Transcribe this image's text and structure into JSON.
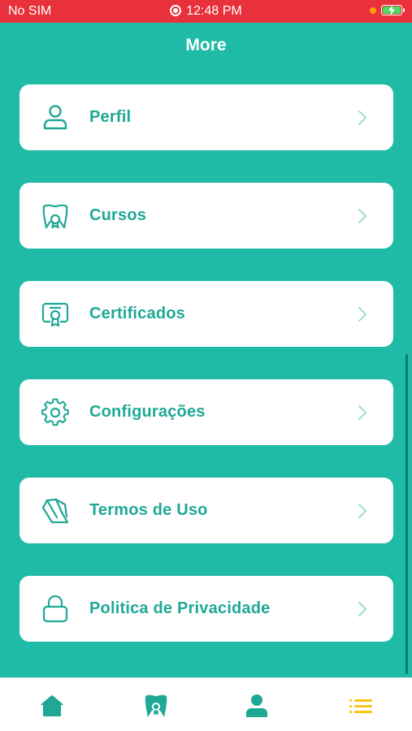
{
  "status_bar": {
    "carrier": "No SIM",
    "time": "12:48 PM"
  },
  "header": {
    "title": "More"
  },
  "menu": {
    "items": [
      {
        "label": "Perfil",
        "icon": "user-icon"
      },
      {
        "label": "Cursos",
        "icon": "tooth-badge-icon"
      },
      {
        "label": "Certificados",
        "icon": "certificate-icon"
      },
      {
        "label": "Configurações",
        "icon": "gear-icon"
      },
      {
        "label": "Termos de Uso",
        "icon": "document-icon"
      },
      {
        "label": "Politica de Privacidade",
        "icon": "lock-icon"
      }
    ]
  },
  "tab_bar": {
    "tabs": [
      {
        "icon": "home-icon",
        "active": false
      },
      {
        "icon": "tooth-badge-icon",
        "active": false
      },
      {
        "icon": "user-icon",
        "active": false
      },
      {
        "icon": "menu-list-icon",
        "active": true
      }
    ]
  },
  "colors": {
    "background": "#1fbba6",
    "accent": "#1fa896",
    "status_bar": "#e8313a",
    "active_tab": "#f5c518"
  }
}
